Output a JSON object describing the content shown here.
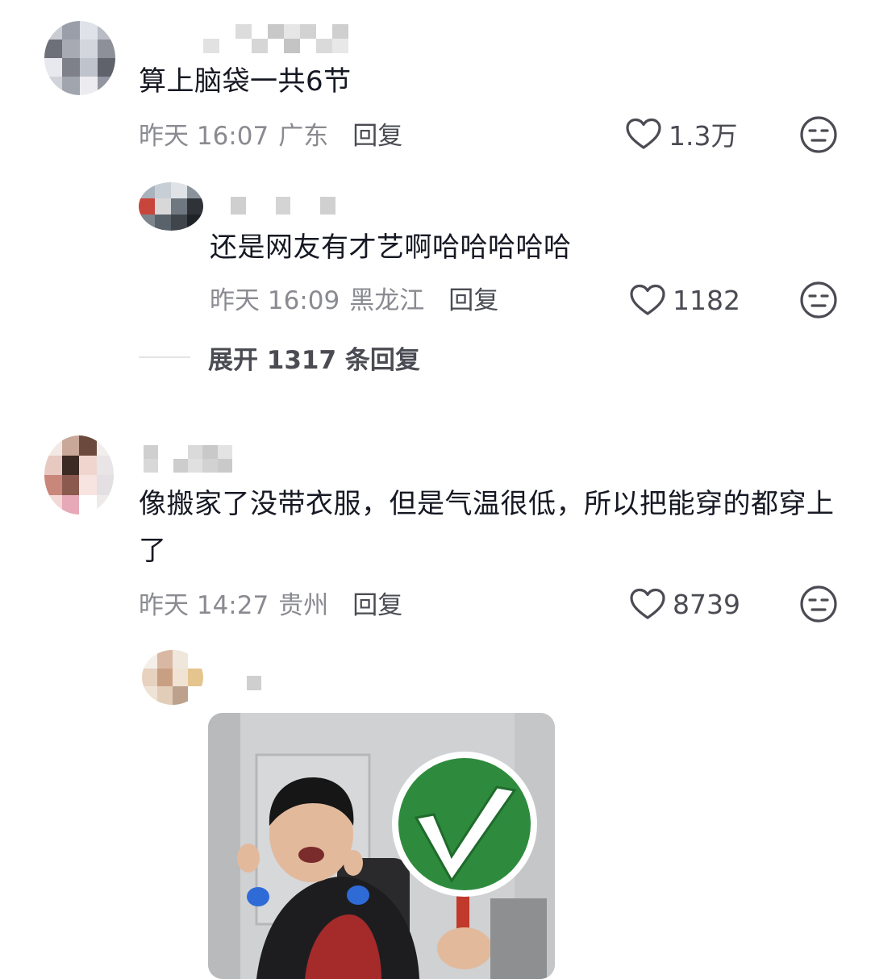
{
  "comments": [
    {
      "text": "算上脑袋一共6节",
      "time": "昨天 16:07",
      "location": "广东",
      "reply_label": "回复",
      "likes": "1.3万",
      "replies": [
        {
          "text": "还是网友有才艺啊哈哈哈哈哈",
          "time": "昨天 16:09",
          "location": "黑龙江",
          "reply_label": "回复",
          "likes": "1182"
        }
      ],
      "expand_label": "展开 1317 条回复"
    },
    {
      "text": "像搬家了没带衣服，但是气温很低，所以把能穿的都穿上了",
      "time": "昨天 14:27",
      "location": "贵州",
      "reply_label": "回复",
      "likes": "8739",
      "replies": [
        {
          "has_image": true,
          "image_desc": "reaction-photo-checkmark"
        }
      ]
    }
  ],
  "colors": {
    "text": "#161823",
    "meta": "#8a8b91",
    "action": "#4b4c53",
    "check_green": "#2e8b3e"
  },
  "icons": [
    "heart-icon",
    "dislike-face-icon"
  ]
}
